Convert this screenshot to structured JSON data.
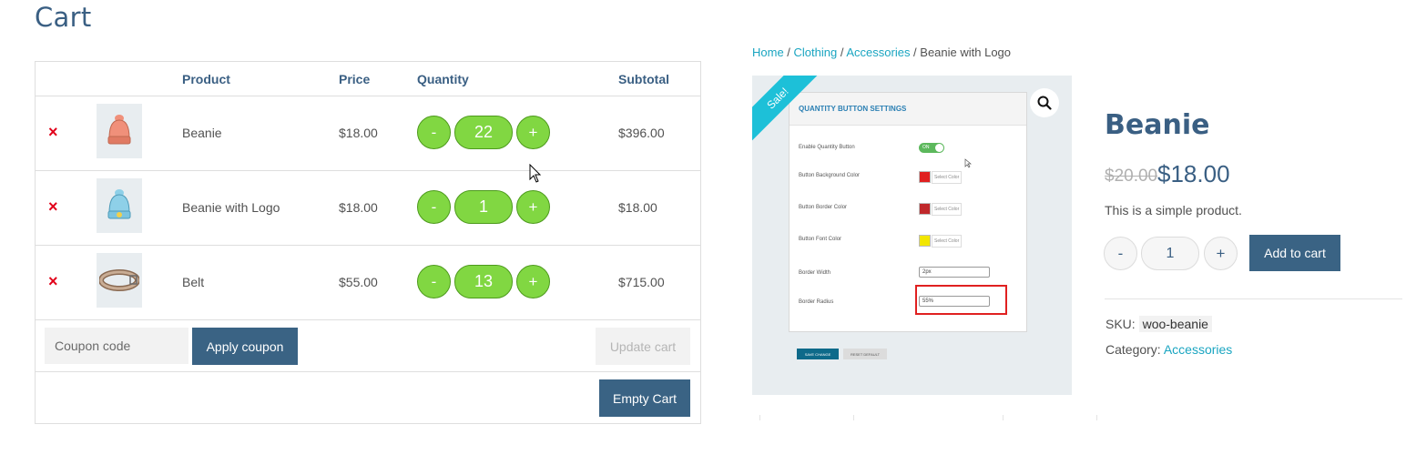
{
  "cart": {
    "title": "Cart",
    "headers": {
      "product": "Product",
      "price": "Price",
      "quantity": "Quantity",
      "subtotal": "Subtotal"
    },
    "items": [
      {
        "name": "Beanie",
        "price": "$18.00",
        "qty": "22",
        "subtotal": "$396.00",
        "thumb_icon": "beanie-icon",
        "thumb_color": "#f0907a"
      },
      {
        "name": "Beanie with Logo",
        "price": "$18.00",
        "qty": "1",
        "subtotal": "$18.00",
        "thumb_icon": "beanie-logo-icon",
        "thumb_color": "#8ed0e8"
      },
      {
        "name": "Belt",
        "price": "$55.00",
        "qty": "13",
        "subtotal": "$715.00",
        "thumb_icon": "belt-icon",
        "thumb_color": "#b89a82"
      }
    ],
    "remove_symbol": "×",
    "minus": "-",
    "plus": "+",
    "coupon_placeholder": "Coupon code",
    "apply_coupon": "Apply coupon",
    "update_cart": "Update cart",
    "empty_cart": "Empty Cart"
  },
  "breadcrumb": {
    "items": [
      "Home",
      "Clothing",
      "Accessories"
    ],
    "current": "Beanie with Logo",
    "separator": " / "
  },
  "product": {
    "sale_badge": "Sale!",
    "title": "Beanie",
    "old_price": "$20.00",
    "price": "$18.00",
    "description": "This is a simple product.",
    "qty": "1",
    "minus": "-",
    "plus": "+",
    "add_to_cart": "Add to cart",
    "sku_label": "SKU:",
    "sku": "woo-beanie",
    "category_label": "Category:",
    "category": "Accessories"
  },
  "settings_image": {
    "heading": "QUANTITY BUTTON SETTINGS",
    "rows": [
      {
        "label": "Enable Quantity Button"
      },
      {
        "label": "Button Background Color",
        "color": "#e02020",
        "select": "Select Color"
      },
      {
        "label": "Button Border Color",
        "color": "#c0282b",
        "select": "Select Color"
      },
      {
        "label": "Button Font Color",
        "color": "#f2e600",
        "select": "Select Color"
      },
      {
        "label": "Border Width",
        "value": "2px"
      },
      {
        "label": "Border Radius",
        "value": "55%"
      }
    ],
    "toggle_text": "ON",
    "save": "SAVE CHANGE",
    "reset": "RESET DEFAULT"
  },
  "colors": {
    "accent": "#3a6384",
    "qty_green": "#81d742",
    "link": "#1aa5c1",
    "remove": "#e2001a"
  }
}
